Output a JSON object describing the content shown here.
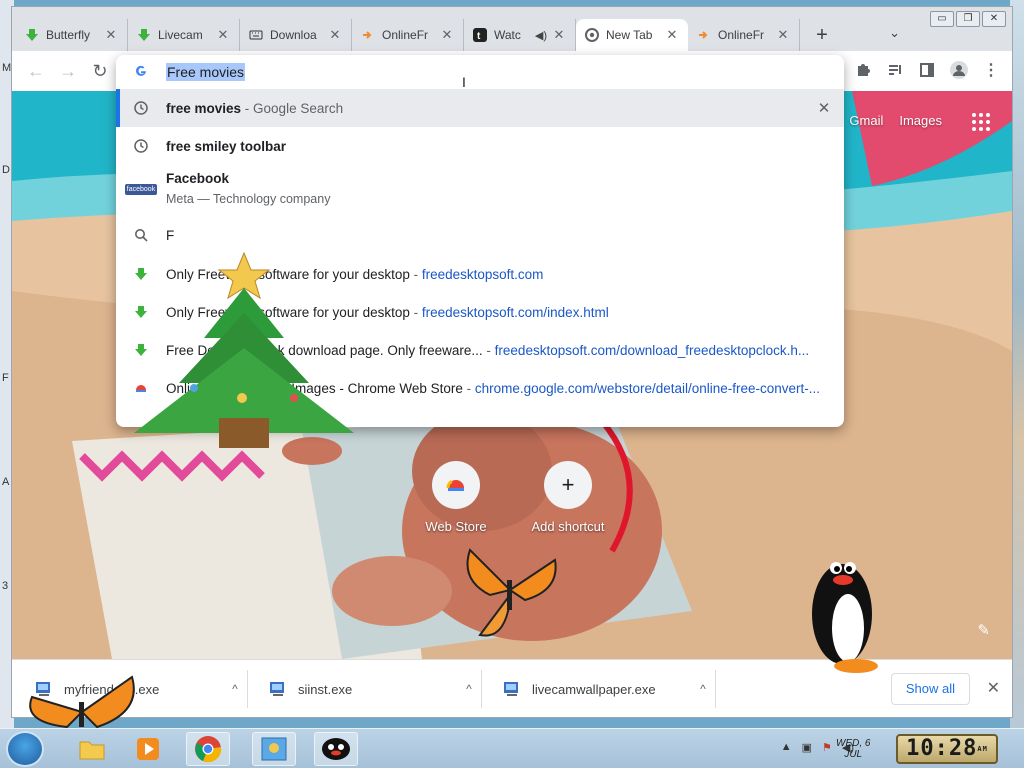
{
  "desktop": {
    "left_letters": [
      "M",
      "D",
      "F",
      "A",
      "3"
    ]
  },
  "window_controls": {
    "minimize": "▭",
    "restore": "❐",
    "close": "✕"
  },
  "tabs": [
    {
      "label": "Butterfly",
      "icon": "green-download-arrow-icon",
      "active": false
    },
    {
      "label": "Livecam",
      "icon": "green-download-arrow-icon",
      "active": false
    },
    {
      "label": "Downloa",
      "icon": "keyboard-icon",
      "active": false
    },
    {
      "label": "OnlineFr",
      "icon": "orange-convert-icon",
      "active": false
    },
    {
      "label": "Watc",
      "icon": "tumblr-icon",
      "active": false,
      "audio": true
    },
    {
      "label": "New Tab",
      "icon": "chrome-icon",
      "active": true
    },
    {
      "label": "OnlineFr",
      "icon": "orange-convert-icon",
      "active": false
    }
  ],
  "tab_close_glyph": "✕",
  "new_tab_glyph": "+",
  "tab_search_glyph": "⌄",
  "omnibox": {
    "text": "Free movies",
    "suggestions": [
      {
        "icon": "history-clock-icon",
        "bold": "free movies",
        "dim": " - Google Search",
        "selected": true,
        "removable": true
      },
      {
        "icon": "history-clock-icon",
        "bold": "free smiley toolbar",
        "dim": ""
      },
      {
        "icon": "facebook-logo-icon",
        "bold": "F",
        "plain": "acebook",
        "sub": "Meta — Technology company"
      },
      {
        "icon": "search-icon",
        "plain": "F"
      },
      {
        "icon": "green-download-arrow-icon",
        "plain": "Only Freeware software for your desktop",
        "dim": " - ",
        "url": "freedesktopsoft.com"
      },
      {
        "icon": "green-download-arrow-icon",
        "plain": "Only Freeware software for your desktop",
        "dim": " - ",
        "url": "freedesktopsoft.com/index.html"
      },
      {
        "icon": "green-download-arrow-icon",
        "plain": "Free Desktop Clock download page. Only freeware...",
        "dim": " - ",
        "url": "freedesktopsoft.com/download_freedesktopclock.h..."
      },
      {
        "icon": "chrome-web-store-icon",
        "plain": "Online Free Convert Images - Chrome Web Store",
        "dim": " - ",
        "url": "chrome.google.com/webstore/detail/online-free-convert-..."
      }
    ]
  },
  "ntp": {
    "links": [
      "Gmail",
      "Images"
    ],
    "shortcuts": [
      {
        "label": "Web Store",
        "icon": "chrome-web-store-icon"
      },
      {
        "label": "Add shortcut",
        "icon": "plus-icon",
        "glyph": "+"
      }
    ],
    "customize_glyph": "✎"
  },
  "downloads": {
    "items": [
      {
        "name": "myfriendsgu.exe"
      },
      {
        "name": "siinst.exe"
      },
      {
        "name": "livecamwallpaper.exe"
      }
    ],
    "caret": "^",
    "show_all": "Show all",
    "close_glyph": "✕"
  },
  "taskbar": {
    "date_line1": "WED, 6",
    "date_line2": "JUL",
    "time": "10:28",
    "ampm": "AM"
  },
  "colors": {
    "accent": "#1a73e8",
    "url": "#1a57c8",
    "selection": "#a8c7fa"
  }
}
